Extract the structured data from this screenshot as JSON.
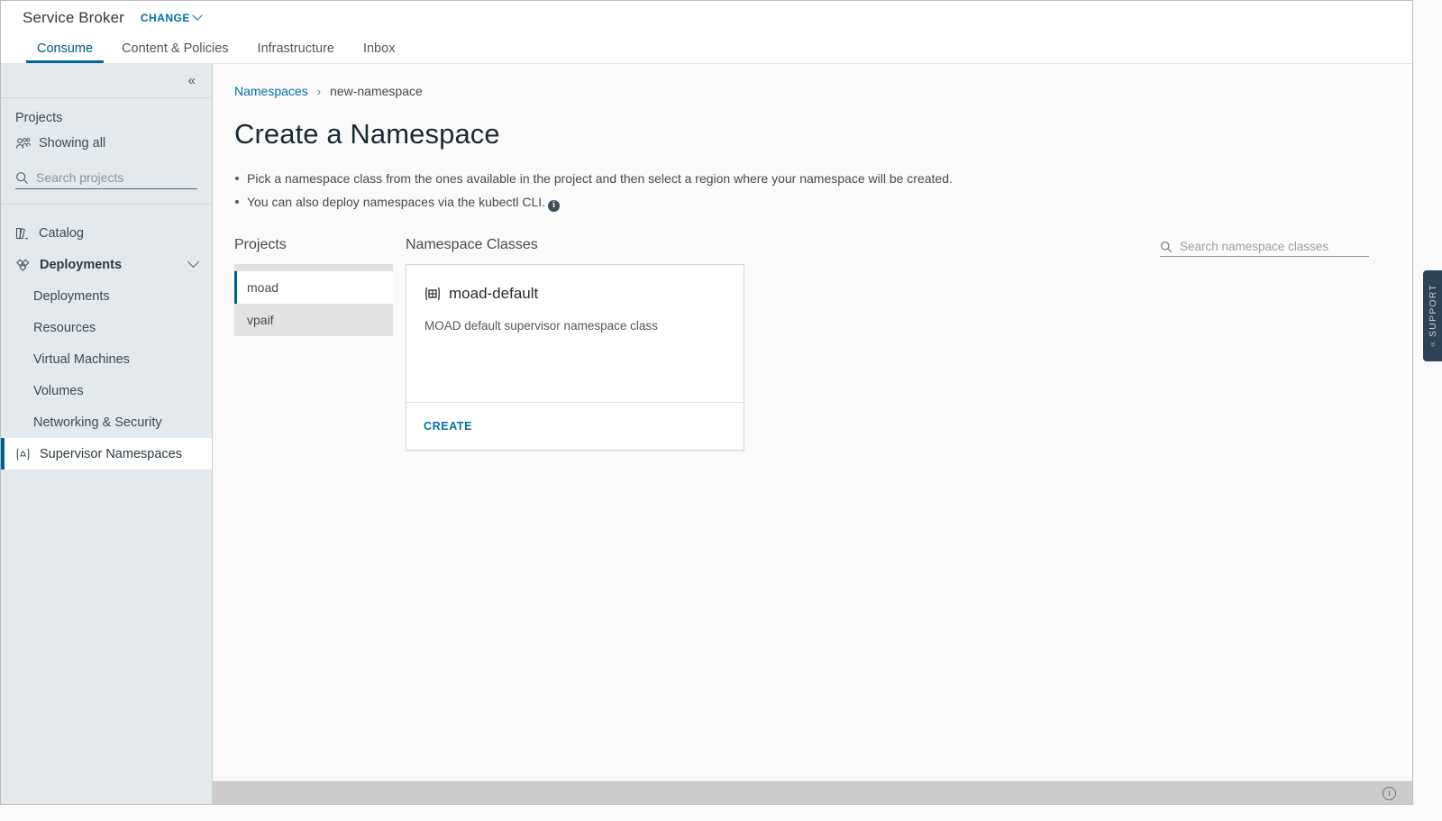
{
  "header": {
    "brand_title": "Service Broker",
    "change_label": "CHANGE",
    "tabs": [
      {
        "label": "Consume",
        "active": true
      },
      {
        "label": "Content & Policies",
        "active": false
      },
      {
        "label": "Infrastructure",
        "active": false
      },
      {
        "label": "Inbox",
        "active": false
      }
    ]
  },
  "sidebar": {
    "collapse_glyph": "«",
    "projects_label": "Projects",
    "showing_all_label": "Showing all",
    "search_placeholder": "Search projects",
    "search_value": "",
    "nav": [
      {
        "label": "Catalog",
        "icon": "catalog-icon",
        "type": "item"
      },
      {
        "label": "Deployments",
        "icon": "deployments-icon",
        "type": "group",
        "expanded": true
      },
      {
        "label": "Deployments",
        "type": "sub"
      },
      {
        "label": "Resources",
        "type": "sub"
      },
      {
        "label": "Virtual Machines",
        "type": "sub"
      },
      {
        "label": "Volumes",
        "type": "sub"
      },
      {
        "label": "Networking & Security",
        "type": "sub"
      },
      {
        "label": "Supervisor Namespaces",
        "icon": "namespace-icon",
        "type": "item",
        "selected": true
      }
    ]
  },
  "main": {
    "breadcrumb": {
      "parent": "Namespaces",
      "separator": "›",
      "current": "new-namespace"
    },
    "page_title": "Create a Namespace",
    "hints": [
      "Pick a namespace class from the ones available in the project and then select a region where your namespace will be created.",
      "You can also deploy namespaces via the kubectl CLI."
    ],
    "info_glyph": "i",
    "projects_column_title": "Projects",
    "classes_column_title": "Namespace Classes",
    "search_classes_placeholder": "Search namespace classes",
    "search_classes_value": "",
    "projects": [
      {
        "name": "moad",
        "selected": true
      },
      {
        "name": "vpaif",
        "selected": false
      }
    ],
    "namespace_classes": [
      {
        "name": "moad-default",
        "description": "MOAD default supervisor namespace class",
        "action_label": "CREATE"
      }
    ]
  },
  "support": {
    "label": "SUPPORT",
    "chevron": "«"
  },
  "footer": {
    "info_glyph": "i"
  },
  "colors": {
    "accent_blue": "#0072a3",
    "active_tab_blue": "#0065ab",
    "selected_bar_blue": "#00628a",
    "sidebar_bg": "#e3e9ec",
    "content_bg": "#fafafa",
    "support_tab_bg": "#2e4355",
    "footer_bg": "#cccccc"
  }
}
